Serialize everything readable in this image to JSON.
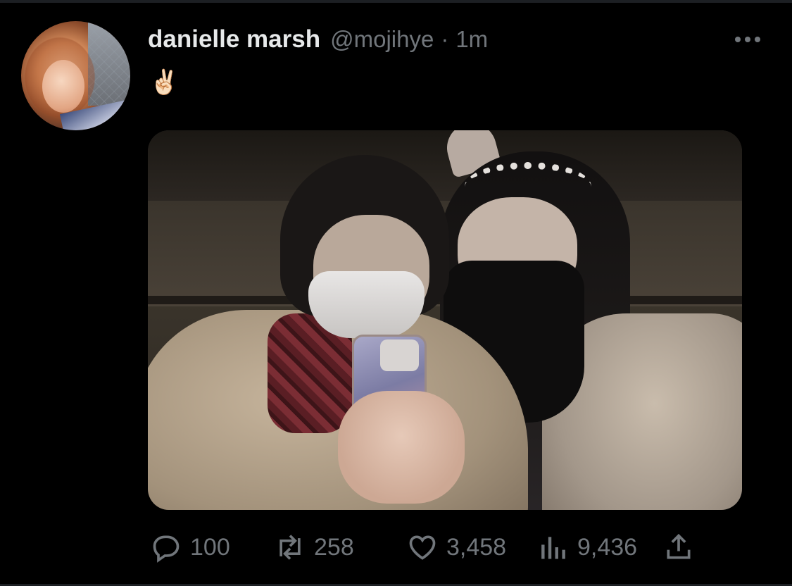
{
  "tweet": {
    "author": {
      "display_name": "danielle marsh",
      "handle": "@mojihye",
      "separator": "·",
      "time": "1m"
    },
    "text": "✌🏻",
    "actions": {
      "reply_count": "100",
      "retweet_count": "258",
      "like_count": "3,458",
      "views_count": "9,436"
    }
  },
  "icons": {
    "more": "more-horizontal-icon",
    "reply": "reply-icon",
    "retweet": "retweet-icon",
    "like": "heart-icon",
    "views": "views-chart-icon",
    "share": "share-icon"
  },
  "colors": {
    "background": "#000000",
    "primary_text": "#e7e9ea",
    "secondary_text": "#71767b"
  }
}
